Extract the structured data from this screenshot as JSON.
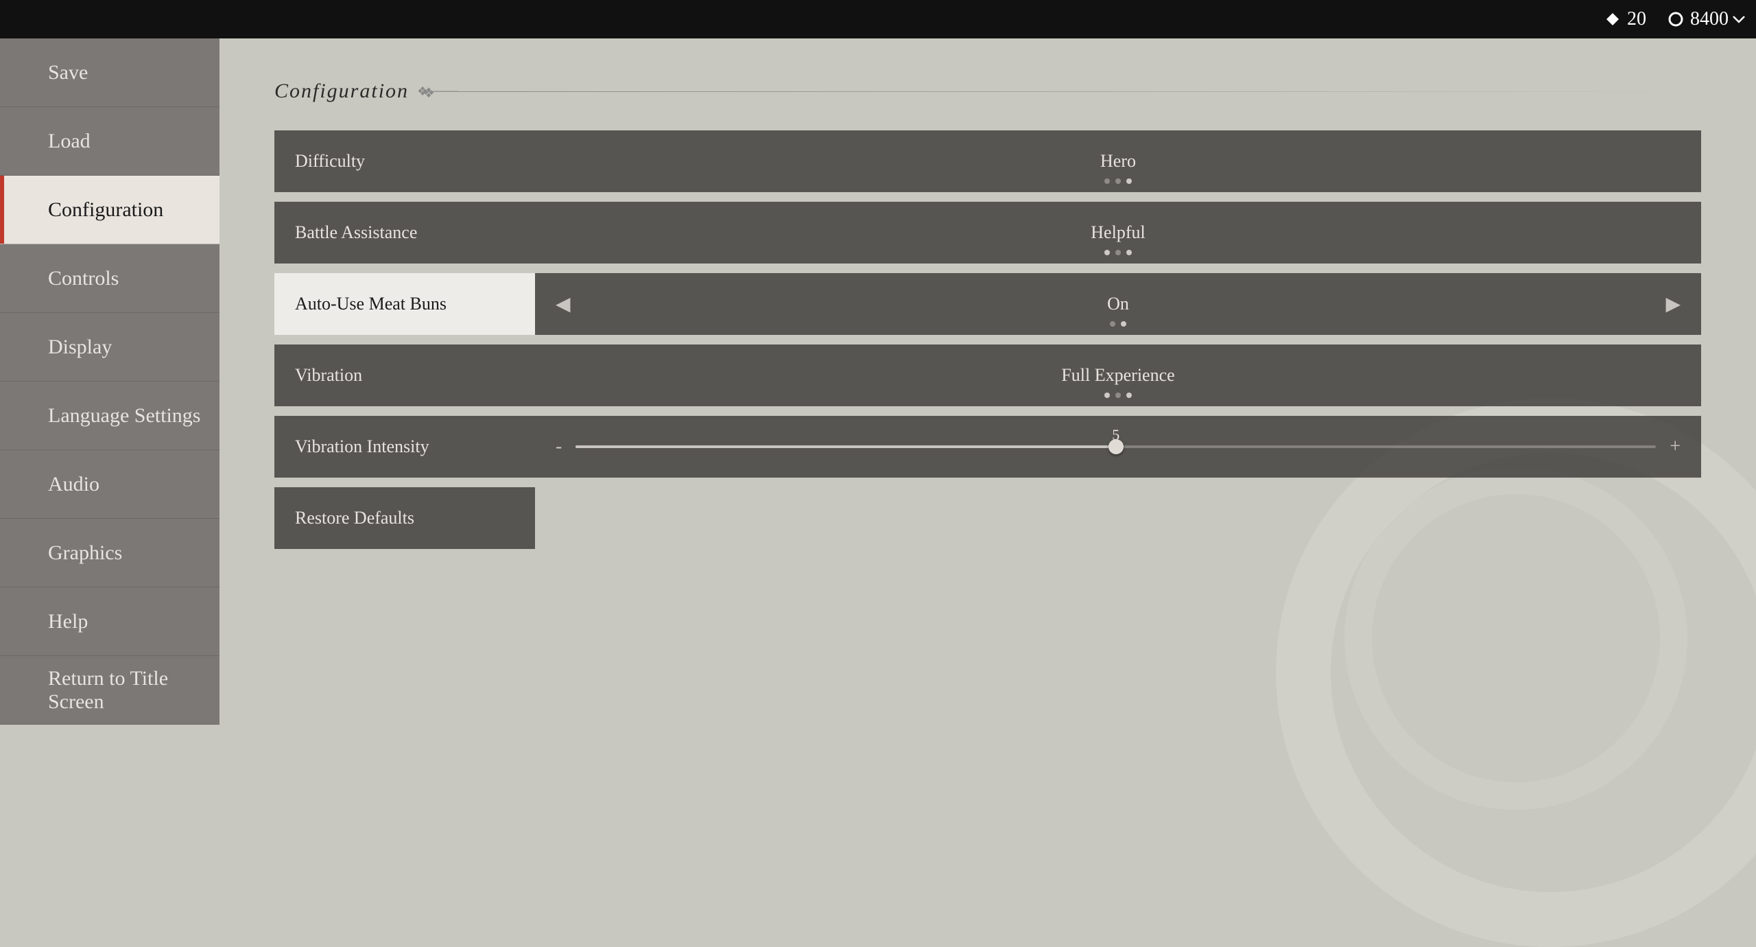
{
  "topbar": {
    "diamond_value": "20",
    "circle_value": "8400"
  },
  "sidebar": {
    "items": [
      {
        "id": "save",
        "label": "Save",
        "active": false
      },
      {
        "id": "load",
        "label": "Load",
        "active": false
      },
      {
        "id": "configuration",
        "label": "Configuration",
        "active": true
      },
      {
        "id": "controls",
        "label": "Controls",
        "active": false
      },
      {
        "id": "display",
        "label": "Display",
        "active": false
      },
      {
        "id": "language-settings",
        "label": "Language Settings",
        "active": false
      },
      {
        "id": "audio",
        "label": "Audio",
        "active": false
      },
      {
        "id": "graphics",
        "label": "Graphics",
        "active": false
      },
      {
        "id": "help",
        "label": "Help",
        "active": false
      },
      {
        "id": "return-to-title",
        "label": "Return to Title Screen",
        "active": false
      }
    ]
  },
  "main": {
    "title": "Configuration",
    "settings": [
      {
        "id": "difficulty",
        "label": "Difficulty",
        "value": "Hero",
        "has_dots": true,
        "dots": [
          0,
          0,
          1
        ],
        "has_arrows": false,
        "is_active": false,
        "is_slider": false
      },
      {
        "id": "battle-assistance",
        "label": "Battle Assistance",
        "value": "Helpful",
        "has_dots": true,
        "dots": [
          1,
          0,
          1
        ],
        "has_arrows": false,
        "is_active": false,
        "is_slider": false
      },
      {
        "id": "auto-use-meat-buns",
        "label": "Auto-Use Meat Buns",
        "value": "On",
        "has_dots": true,
        "dots": [
          0,
          1
        ],
        "has_arrows": true,
        "is_active": true,
        "is_slider": false
      },
      {
        "id": "vibration",
        "label": "Vibration",
        "value": "Full Experience",
        "has_dots": true,
        "dots": [
          1,
          0,
          1
        ],
        "has_arrows": false,
        "is_active": false,
        "is_slider": false
      },
      {
        "id": "vibration-intensity",
        "label": "Vibration Intensity",
        "value": "5",
        "has_dots": false,
        "has_arrows": false,
        "is_active": false,
        "is_slider": true,
        "slider_min_label": "-",
        "slider_max_label": "+",
        "slider_percent": 50
      }
    ],
    "restore_defaults_label": "Restore Defaults"
  }
}
